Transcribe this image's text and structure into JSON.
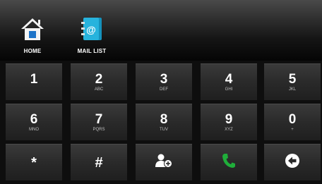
{
  "nav": {
    "home_label": "HOME",
    "mail_list_label": "MAIL LIST"
  },
  "keypad": {
    "keys": [
      {
        "digit": "1",
        "letters": ""
      },
      {
        "digit": "2",
        "letters": "ABC"
      },
      {
        "digit": "3",
        "letters": "DEF"
      },
      {
        "digit": "4",
        "letters": "GHI"
      },
      {
        "digit": "5",
        "letters": "JKL"
      },
      {
        "digit": "6",
        "letters": "MNO"
      },
      {
        "digit": "7",
        "letters": "PQRS"
      },
      {
        "digit": "8",
        "letters": "TUV"
      },
      {
        "digit": "9",
        "letters": "XYZ"
      },
      {
        "digit": "0",
        "letters": "+"
      },
      {
        "digit": "*"
      },
      {
        "digit": "#"
      }
    ],
    "action_icons": [
      "add-contact-icon",
      "call-icon",
      "backspace-icon"
    ]
  },
  "colors": {
    "call_green": "#1fae3a",
    "home_blue": "#1e74c8",
    "mail_teal": "#19a7cf"
  }
}
